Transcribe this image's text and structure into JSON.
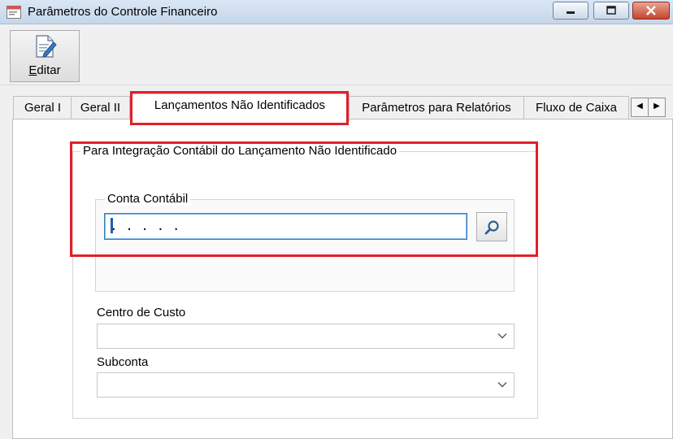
{
  "window": {
    "title": "Parâmetros do Controle Financeiro",
    "app_icon": "form-icon",
    "controls": [
      "minimize-icon",
      "maximize-icon",
      "close-icon"
    ]
  },
  "toolbar": {
    "editar": {
      "accel": "E",
      "rest": "ditar",
      "icon": "edit-document-icon"
    }
  },
  "tabs": [
    {
      "label": "Geral I"
    },
    {
      "label": "Geral II"
    },
    {
      "label": "Lançamentos Não Identificados",
      "active": true
    },
    {
      "label": "Parâmetros para Relatórios"
    },
    {
      "label": "Fluxo de Caixa"
    }
  ],
  "tab_scroll": {
    "left": "◀",
    "right": "▶"
  },
  "panel": {
    "group_title": "Para Integração Contábil do Lançamento Não Identificado",
    "conta_contabil": {
      "label": "Conta Contábil",
      "value": ". . . . .",
      "search_icon": "search-icon"
    },
    "centro_custo": {
      "label": "Centro de Custo",
      "value": ""
    },
    "subconta": {
      "label": "Subconta",
      "value": ""
    }
  },
  "highlight_color": "#e0202a"
}
